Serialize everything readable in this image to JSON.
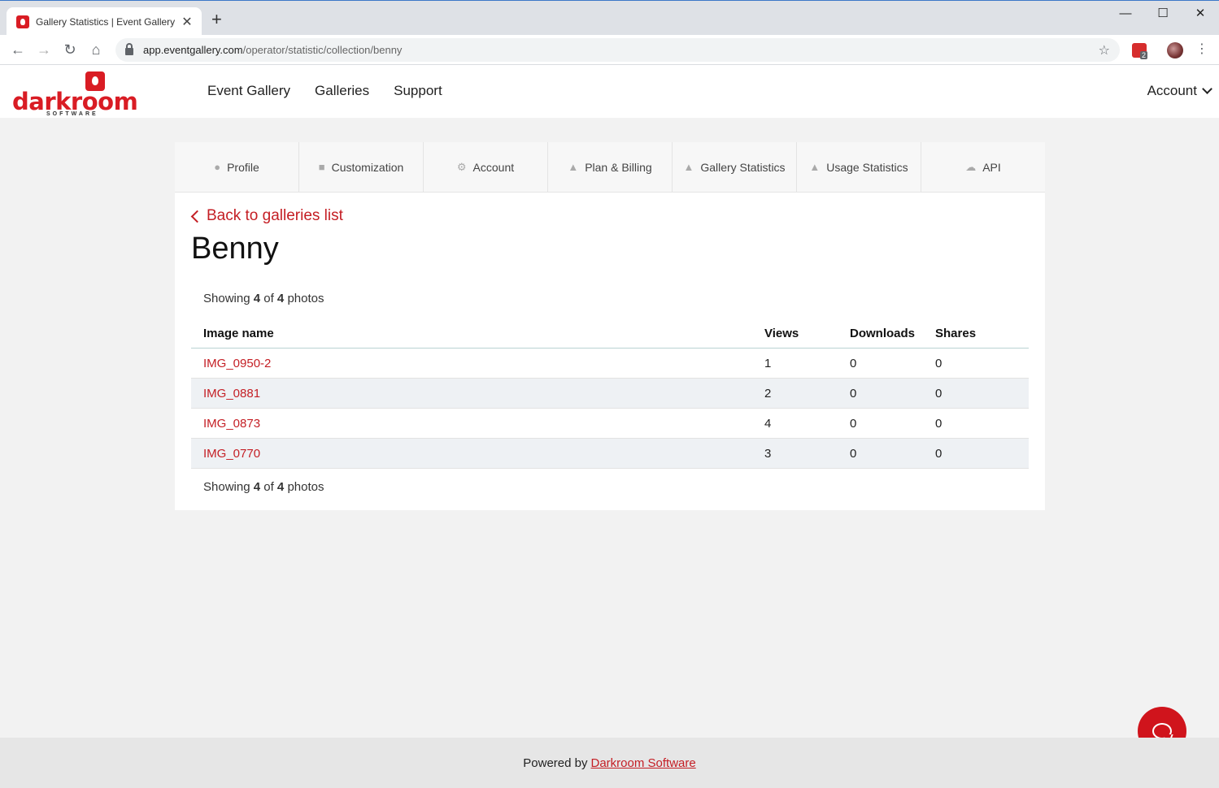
{
  "browser": {
    "tab_title": "Gallery Statistics | Event Gallery",
    "tab_close": "✕",
    "new_tab": "+",
    "url_host": "app.eventgallery.com",
    "url_path": "/operator/statistic/collection/benny",
    "extension_badge": "2"
  },
  "logo": {
    "text": "darkroom",
    "sub": "SOFTWARE"
  },
  "nav": {
    "items": [
      "Event Gallery",
      "Galleries",
      "Support"
    ],
    "account": "Account"
  },
  "settings_tabs": [
    {
      "label": "Profile",
      "icon": "person-icon"
    },
    {
      "label": "Customization",
      "icon": "lock-icon"
    },
    {
      "label": "Account",
      "icon": "gear-icon"
    },
    {
      "label": "Plan & Billing",
      "icon": "thumbs-up-icon"
    },
    {
      "label": "Gallery Statistics",
      "icon": "thumbs-up-icon"
    },
    {
      "label": "Usage Statistics",
      "icon": "thumbs-up-icon"
    },
    {
      "label": "API",
      "icon": "cloud-icon"
    }
  ],
  "content": {
    "back_label": "Back to galleries list",
    "title": "Benny",
    "showing_prefix": "Showing",
    "showing_count": "4",
    "showing_of": "of",
    "showing_total": "4",
    "showing_suffix": "photos"
  },
  "table": {
    "headers": {
      "name": "Image name",
      "views": "Views",
      "downloads": "Downloads",
      "shares": "Shares"
    },
    "rows": [
      {
        "name": "IMG_0950-2",
        "views": "1",
        "downloads": "0",
        "shares": "0"
      },
      {
        "name": "IMG_0881",
        "views": "2",
        "downloads": "0",
        "shares": "0"
      },
      {
        "name": "IMG_0873",
        "views": "4",
        "downloads": "0",
        "shares": "0"
      },
      {
        "name": "IMG_0770",
        "views": "3",
        "downloads": "0",
        "shares": "0"
      }
    ]
  },
  "footer": {
    "prefix": "Powered by",
    "link": "Darkroom Software"
  },
  "colors": {
    "brand_red": "#c41e24",
    "chat_red": "#d0141c"
  }
}
